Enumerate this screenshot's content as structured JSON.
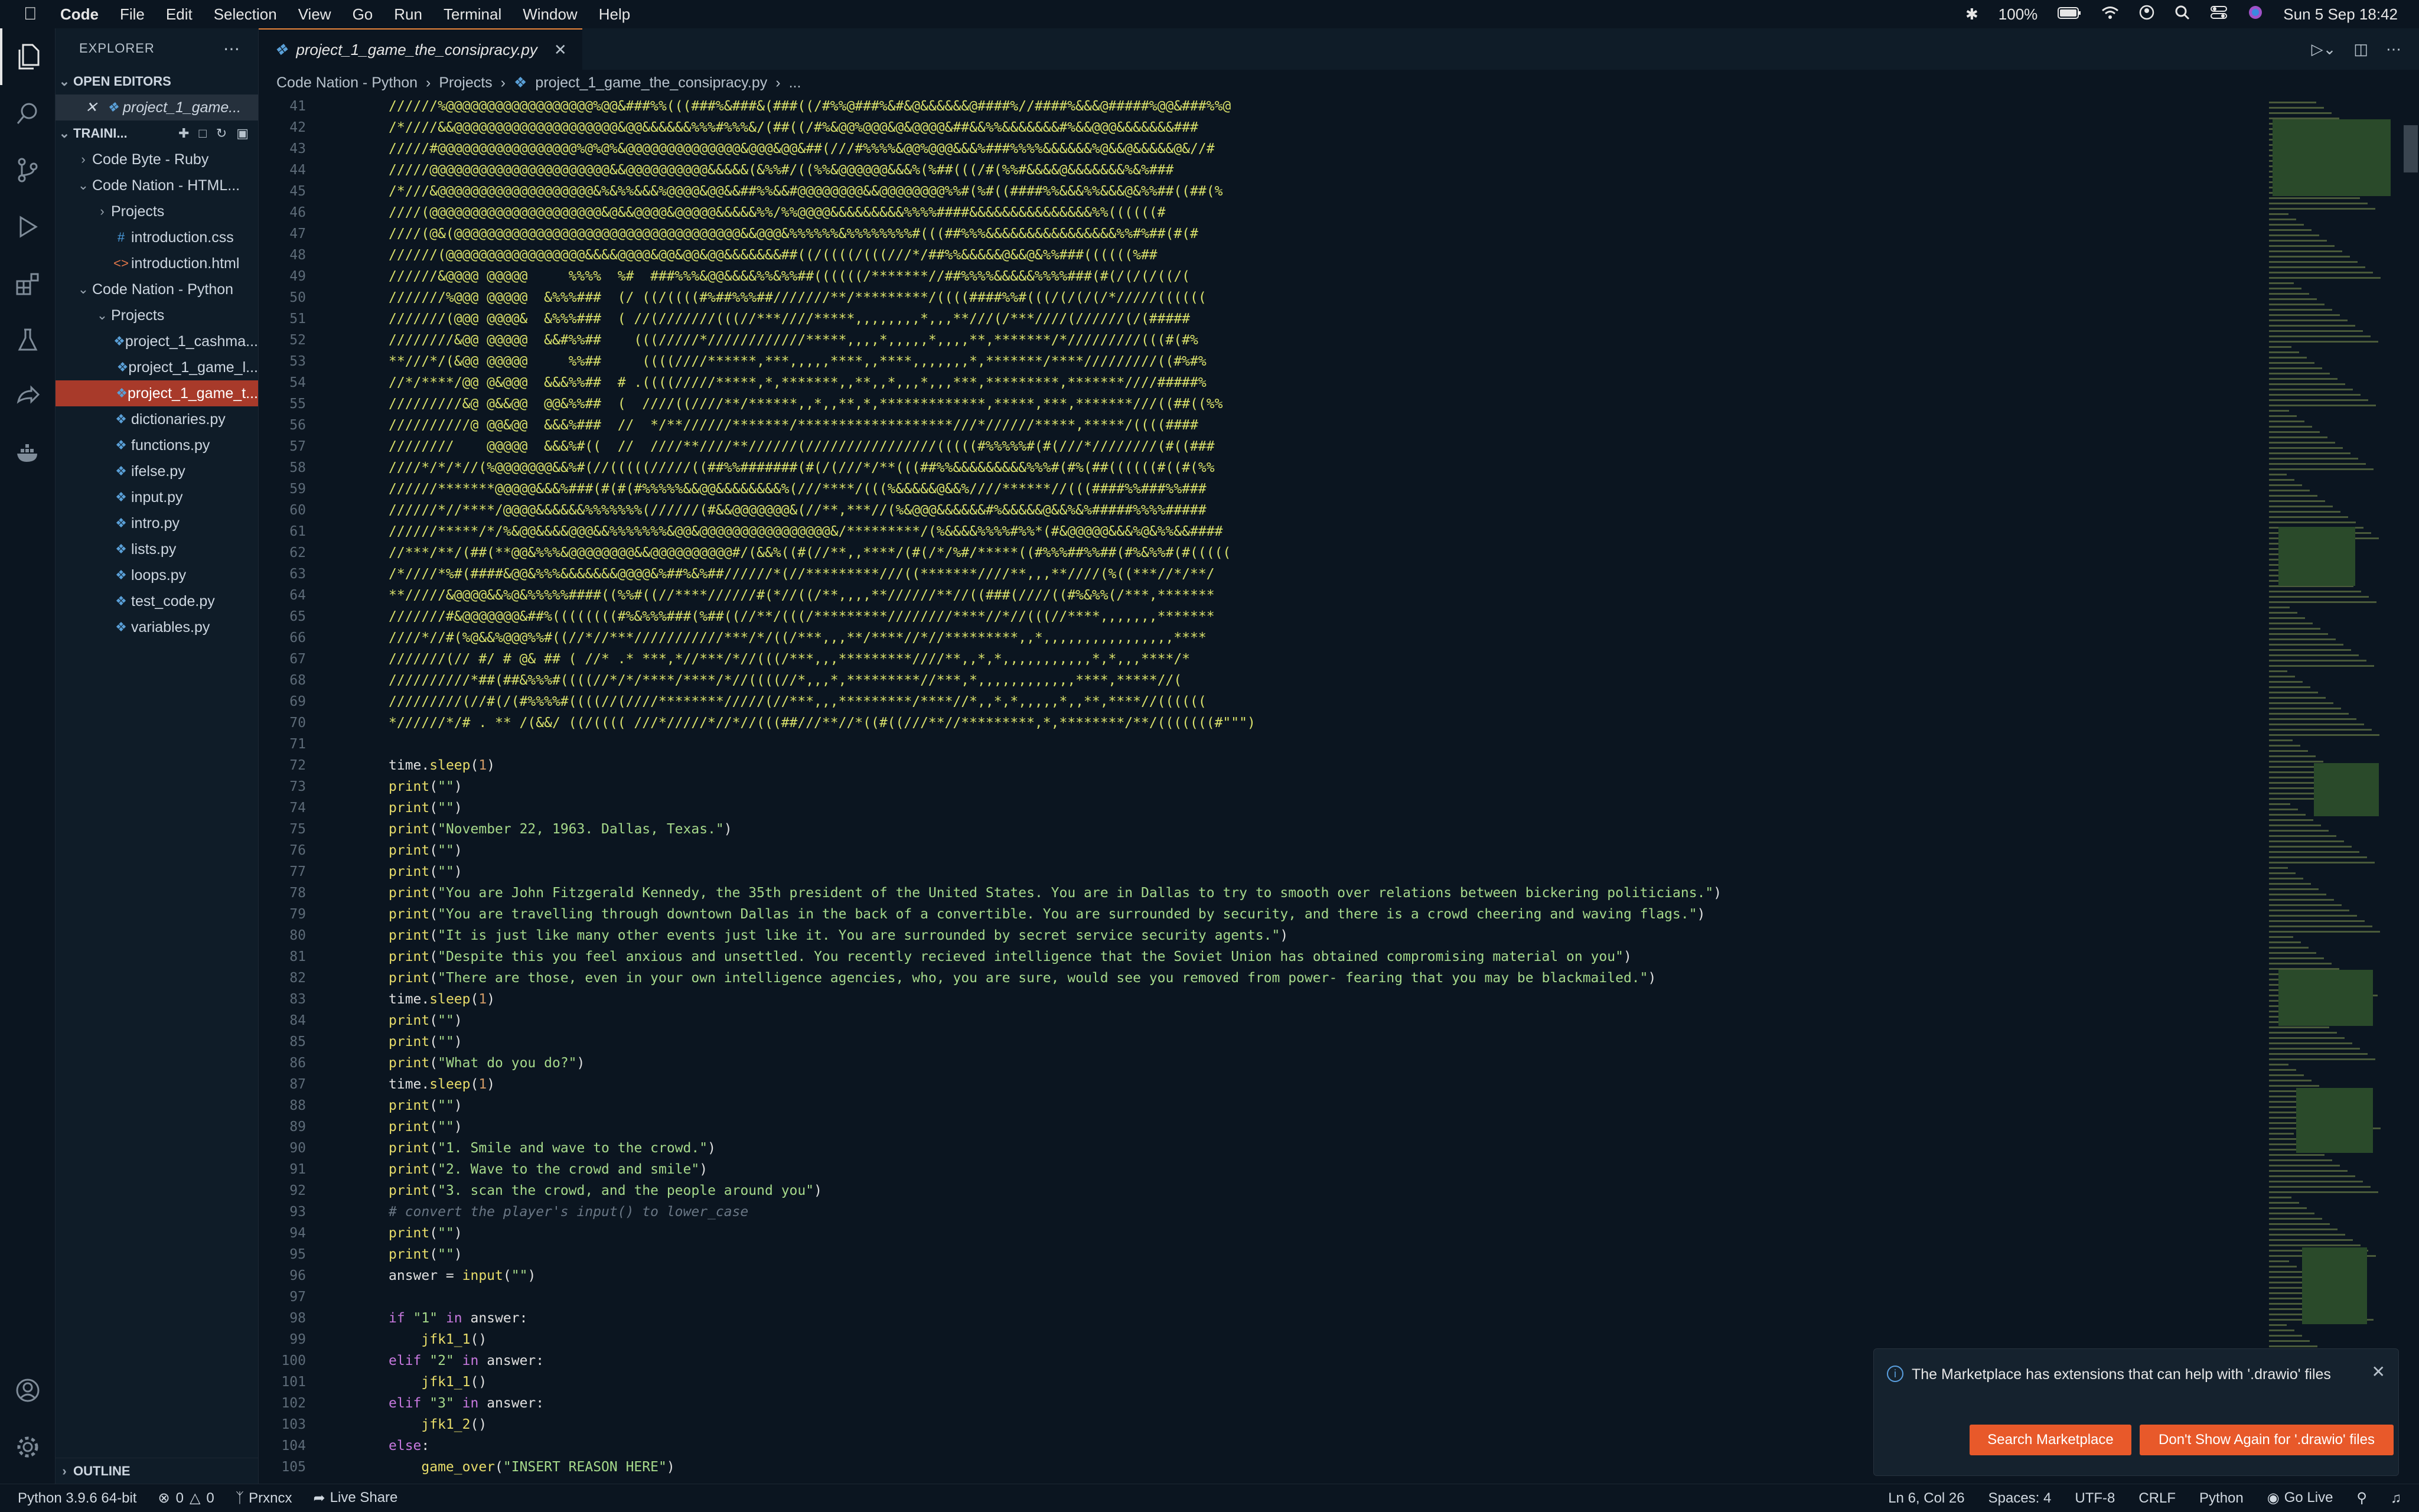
{
  "menubar": {
    "app": "Code",
    "items": [
      "File",
      "Edit",
      "Selection",
      "View",
      "Go",
      "Run",
      "Terminal",
      "Window",
      "Help"
    ],
    "battery": "100%",
    "datetime": "Sun 5 Sep  18:42"
  },
  "explorer": {
    "title": "EXPLORER",
    "open_editors": "OPEN EDITORS",
    "open_file": "project_1_game...",
    "workspace": "TRAINI...",
    "tree": [
      {
        "label": "Code Byte - Ruby",
        "indent": 1,
        "kind": "folder",
        "open": false
      },
      {
        "label": "Code Nation - HTML...",
        "indent": 1,
        "kind": "folder",
        "open": true
      },
      {
        "label": "Projects",
        "indent": 2,
        "kind": "folder",
        "open": false
      },
      {
        "label": "introduction.css",
        "indent": 2,
        "kind": "css"
      },
      {
        "label": "introduction.html",
        "indent": 2,
        "kind": "html"
      },
      {
        "label": "Code Nation - Python",
        "indent": 1,
        "kind": "folder",
        "open": true
      },
      {
        "label": "Projects",
        "indent": 2,
        "kind": "folder",
        "open": true
      },
      {
        "label": "project_1_cashma...",
        "indent": 3,
        "kind": "py"
      },
      {
        "label": "project_1_game_l...",
        "indent": 3,
        "kind": "py"
      },
      {
        "label": "project_1_game_t...",
        "indent": 3,
        "kind": "py",
        "selected": true
      },
      {
        "label": "dictionaries.py",
        "indent": 2,
        "kind": "py"
      },
      {
        "label": "functions.py",
        "indent": 2,
        "kind": "py"
      },
      {
        "label": "ifelse.py",
        "indent": 2,
        "kind": "py"
      },
      {
        "label": "input.py",
        "indent": 2,
        "kind": "py"
      },
      {
        "label": "intro.py",
        "indent": 2,
        "kind": "py"
      },
      {
        "label": "lists.py",
        "indent": 2,
        "kind": "py"
      },
      {
        "label": "loops.py",
        "indent": 2,
        "kind": "py"
      },
      {
        "label": "test_code.py",
        "indent": 2,
        "kind": "py"
      },
      {
        "label": "variables.py",
        "indent": 2,
        "kind": "py"
      }
    ],
    "outline": "OUTLINE"
  },
  "tab": {
    "label": "project_1_game_the_consipracy.py"
  },
  "breadcrumb": [
    "Code Nation - Python",
    "Projects",
    "project_1_game_the_consipracy.py",
    "..."
  ],
  "art_lines": [
    {
      "n": 41,
      "t": "//////%@@@@@@@@@@@@@@@@@@%@@&###%%(((###%&###&(###((/#%%@###%&#&@&&&&&&@####%//####%&&&@#####%@@&###%%@"
    },
    {
      "n": 42,
      "t": "/*////&&@@@@@@@@@@@@@@@@@@@@&@@&&&&&&%%%#%%%&/(##((/#%&@@%@@@&@&@@@@&##&&%%&&&&&&&#%&&@@@&&&&&&&###"
    },
    {
      "n": 43,
      "t": "/////#@@@@@@@@@@@@@@@@@%@%@%&@@@@@@@@@@@@@@&@@@&@@&##(///#%%%%&@@%@@@&&&%###%%%%&&&&&&%@&&@&&&&&@&//#"
    },
    {
      "n": 44,
      "t": "/////@@@@@@@@@@@@@@@@@@@@@@&&@@@@@@@@@@&&&&&(&%%#/((%%&@@@@@@&&&%(%##(((/#(%%#&&&&@&&&&&&&%&%###"
    },
    {
      "n": 45,
      "t": "/*///&@@@@@@@@@@@@@@@@@@@&%&%%&&&%@@@@&@@&&##%%&&#@@@@@@@@&&@@@@@@@@%%#(%#((####%%&&&%%&&&@&%%##((##(%"
    },
    {
      "n": 46,
      "t": "////(@@@@@@@@@@@@@@@@@@@@@&@&&@@@@&@@@@@&&&&&%%/%%@@@@&&&&&&&&&%%%%####&&&&&&&&&&&&&&&%%((((((#"
    },
    {
      "n": 47,
      "t": "////(@&(@@@@@@@@@@@@@@@@@@@@@@@@@@@@@@@@@@@&&@@@&%%%%%%&%%%%%%%%#(((##%%%&&&&&&&&&&&&&&&&%%#%##(#(#"
    },
    {
      "n": 48,
      "t": "//////(@@@@@@@@@@@@@@@@@&&&&@@@@&@@&@@&@@&&&&&&&##((/((((/(((///*/##%%&&&&&@&&@&%%###((((((%##"
    },
    {
      "n": 49,
      "t": "//////&@@@@ @@@@@     %%%%  %#  ###%%%&@@&&&&%%&%%##((((((/*******//##%%%%&&&&&%%%%###(#(/(/(/((/("
    },
    {
      "n": 50,
      "t": "///////%@@@ @@@@@  &%%%###  (/ ((/((((#%##%%%##///////**/*********/((((####%%#(((/(/(/(/*/////(((((("
    },
    {
      "n": 51,
      "t": "///////(@@@ @@@@&  &%%%###  ( //(///////(((//***////*****,,,,,,,,*,,,**///(/***////(//////(/(#####"
    },
    {
      "n": 52,
      "t": "////////&@@ @@@@@  &&#%%##    (((/////*////////////*****,,,,*,,,,,*,,,,**,*******/*/////////(((#(#%"
    },
    {
      "n": 53,
      "t": "**///*/(&@@ @@@@@     %%##     ((((////******,***,,,,,****,,****,,,,,,,*,*******/****/////////((#%#%"
    },
    {
      "n": 54,
      "t": "//*/****/@@ @&@@@  &&&%%##  # .((((/////*****,*,*******,,**,,*,,,*,,,***,*********,*******////#####%"
    },
    {
      "n": 55,
      "t": "/////////&@ @&&@@  @@&%%##  (  ////((////**/******,,*,,**,*,*************,*****,***,*******///((##((%%"
    },
    {
      "n": 56,
      "t": "//////////@ @@&@@  &&&%###  //  */**//////*******/*******************///*//////*****,*****/((((####"
    },
    {
      "n": 57,
      "t": "////////    @@@@@  &&&%#((  //  ////**////**//////(////////////////(((((#%%%%%#(#(///*////////(#((###"
    },
    {
      "n": 58,
      "t": "////*/*/*//(%@@@@@@@&&%#(//(((((/////((##%%#######(#(/(///*/**(((##%%&&&&&&&&&%%%#(#%(##((((((#((#(%%"
    },
    {
      "n": 59,
      "t": "//////*******@@@@@&&&%###(#(#(#%%%%%&&@@&&&&&&&&%(///****/(((%&&&&&@&&%////******//(((####%%###%%###"
    },
    {
      "n": 60,
      "t": "//////*//****/@@@@&&&&&&%%%%%%%(//////(#&&@@@@@@@&(//**,***//(%&@@@&&&&&&#%&&&&&@&&%&%#####%%%%#####"
    },
    {
      "n": 61,
      "t": "//////*****/*/%&@@&&&&@@@&&%%%%%%%&@@&@@@@@@@@@@@@@@@@&/*********/(%&&&&%%%%#%%*(#&@@@@@&&&%@&%%&&####"
    },
    {
      "n": 62,
      "t": "//***/**/(##(**@@&%%%&@@@@@@@@&&@@@@@@@@@@#/(&&%((#(//**,,****/(#(/*/%#/*****((#%%%##%%##(#%&%%#(#((((("
    },
    {
      "n": 63,
      "t": "/*////*%#(####&@@&%%%&&&&&&&@@@@&%##%&%##//////*(//*********///((*******////**,,,**////(%((***//*/**/"
    },
    {
      "n": 64,
      "t": "**/////&@@@@&&%@&%%%%%####((%%#((//****//////#(*//((/**,,,,**//////**//((###(////((#%&%%(/***,*******"
    },
    {
      "n": 65,
      "t": "///////#&@@@@@@@&##%((((((((#%&%%%###(%##((//**/(((/*********////////****//*//(((//****,,,,,,,*******"
    },
    {
      "n": 66,
      "t": "////*//#(%@&&%@@@%%#((//*//***///////////***/*/((/***,,,**/****//*//*********,,*,,,,,,,,,,,,,,,,****"
    },
    {
      "n": 67,
      "t": "///////(// #/ # @& ## ( //* .* ***,*//***/*//(((/***,,,*********////**,,*,*,,,,,,,,,,,*,*,,,****/*"
    },
    {
      "n": 68,
      "t": "//////////*##(##&%%%#((((//*/*/****/****/*//((((//*,,,*,*********//***,*,,,,,,,,,,,,****,*****//("
    },
    {
      "n": 69,
      "t": "/////////(//#(/(#%%%%#((((//(////********/////(//***,,,*********/****//*,,*,*,,,,,*,,**,****//(((((("
    },
    {
      "n": 70,
      "t": "*//////*/# . ** /(&&/ ((/(((( ///*/////*//*//(((##///**//*((#((///**//*********,*,********/**/(((((((#\"\"\")"
    }
  ],
  "code_lines": [
    {
      "n": 71,
      "seg": []
    },
    {
      "n": 72,
      "seg": [
        [
          "time.",
          "k-var"
        ],
        [
          "sleep",
          "k-fn"
        ],
        [
          "(",
          "k-pl"
        ],
        [
          "1",
          "k-num"
        ],
        [
          ")",
          "k-pl"
        ]
      ]
    },
    {
      "n": 73,
      "seg": [
        [
          "print",
          "k-fn"
        ],
        [
          "(",
          "k-pl"
        ],
        [
          "\"\"",
          "k-str"
        ],
        [
          ")",
          "k-pl"
        ]
      ]
    },
    {
      "n": 74,
      "seg": [
        [
          "print",
          "k-fn"
        ],
        [
          "(",
          "k-pl"
        ],
        [
          "\"\"",
          "k-str"
        ],
        [
          ")",
          "k-pl"
        ]
      ]
    },
    {
      "n": 75,
      "seg": [
        [
          "print",
          "k-fn"
        ],
        [
          "(",
          "k-pl"
        ],
        [
          "\"November 22, 1963. Dallas, Texas.\"",
          "k-str"
        ],
        [
          ")",
          "k-pl"
        ]
      ]
    },
    {
      "n": 76,
      "seg": [
        [
          "print",
          "k-fn"
        ],
        [
          "(",
          "k-pl"
        ],
        [
          "\"\"",
          "k-str"
        ],
        [
          ")",
          "k-pl"
        ]
      ]
    },
    {
      "n": 77,
      "seg": [
        [
          "print",
          "k-fn"
        ],
        [
          "(",
          "k-pl"
        ],
        [
          "\"\"",
          "k-str"
        ],
        [
          ")",
          "k-pl"
        ]
      ]
    },
    {
      "n": 78,
      "seg": [
        [
          "print",
          "k-fn"
        ],
        [
          "(",
          "k-pl"
        ],
        [
          "\"You are John Fitzgerald Kennedy, the 35th president of the United States. You are in Dallas to try to smooth over relations between bickering politicians.\"",
          "k-str"
        ],
        [
          ")",
          "k-pl"
        ]
      ]
    },
    {
      "n": 79,
      "seg": [
        [
          "print",
          "k-fn"
        ],
        [
          "(",
          "k-pl"
        ],
        [
          "\"You are travelling through downtown Dallas in the back of a convertible. You are surrounded by security, and there is a crowd cheering and waving flags.\"",
          "k-str"
        ],
        [
          ")",
          "k-pl"
        ]
      ]
    },
    {
      "n": 80,
      "seg": [
        [
          "print",
          "k-fn"
        ],
        [
          "(",
          "k-pl"
        ],
        [
          "\"It is just like many other events just like it. You are surrounded by secret service security agents.\"",
          "k-str"
        ],
        [
          ")",
          "k-pl"
        ]
      ]
    },
    {
      "n": 81,
      "seg": [
        [
          "print",
          "k-fn"
        ],
        [
          "(",
          "k-pl"
        ],
        [
          "\"Despite this you feel anxious and unsettled. You recently recieved intelligence that the Soviet Union has obtained compromising material on you\"",
          "k-str"
        ],
        [
          ")",
          "k-pl"
        ]
      ]
    },
    {
      "n": 82,
      "seg": [
        [
          "print",
          "k-fn"
        ],
        [
          "(",
          "k-pl"
        ],
        [
          "\"There are those, even in your own intelligence agencies, who, you are sure, would see you removed from power- fearing that you may be blackmailed.\"",
          "k-str"
        ],
        [
          ")",
          "k-pl"
        ]
      ]
    },
    {
      "n": 83,
      "seg": [
        [
          "time.",
          "k-var"
        ],
        [
          "sleep",
          "k-fn"
        ],
        [
          "(",
          "k-pl"
        ],
        [
          "1",
          "k-num"
        ],
        [
          ")",
          "k-pl"
        ]
      ]
    },
    {
      "n": 84,
      "seg": [
        [
          "print",
          "k-fn"
        ],
        [
          "(",
          "k-pl"
        ],
        [
          "\"\"",
          "k-str"
        ],
        [
          ")",
          "k-pl"
        ]
      ]
    },
    {
      "n": 85,
      "seg": [
        [
          "print",
          "k-fn"
        ],
        [
          "(",
          "k-pl"
        ],
        [
          "\"\"",
          "k-str"
        ],
        [
          ")",
          "k-pl"
        ]
      ]
    },
    {
      "n": 86,
      "seg": [
        [
          "print",
          "k-fn"
        ],
        [
          "(",
          "k-pl"
        ],
        [
          "\"What do you do?\"",
          "k-str"
        ],
        [
          ")",
          "k-pl"
        ]
      ]
    },
    {
      "n": 87,
      "seg": [
        [
          "time.",
          "k-var"
        ],
        [
          "sleep",
          "k-fn"
        ],
        [
          "(",
          "k-pl"
        ],
        [
          "1",
          "k-num"
        ],
        [
          ")",
          "k-pl"
        ]
      ]
    },
    {
      "n": 88,
      "seg": [
        [
          "print",
          "k-fn"
        ],
        [
          "(",
          "k-pl"
        ],
        [
          "\"\"",
          "k-str"
        ],
        [
          ")",
          "k-pl"
        ]
      ]
    },
    {
      "n": 89,
      "seg": [
        [
          "print",
          "k-fn"
        ],
        [
          "(",
          "k-pl"
        ],
        [
          "\"\"",
          "k-str"
        ],
        [
          ")",
          "k-pl"
        ]
      ]
    },
    {
      "n": 90,
      "seg": [
        [
          "print",
          "k-fn"
        ],
        [
          "(",
          "k-pl"
        ],
        [
          "\"1. Smile and wave to the crowd.\"",
          "k-str"
        ],
        [
          ")",
          "k-pl"
        ]
      ]
    },
    {
      "n": 91,
      "seg": [
        [
          "print",
          "k-fn"
        ],
        [
          "(",
          "k-pl"
        ],
        [
          "\"2. Wave to the crowd and smile\"",
          "k-str"
        ],
        [
          ")",
          "k-pl"
        ]
      ]
    },
    {
      "n": 92,
      "seg": [
        [
          "print",
          "k-fn"
        ],
        [
          "(",
          "k-pl"
        ],
        [
          "\"3. scan the crowd, and the people around you\"",
          "k-str"
        ],
        [
          ")",
          "k-pl"
        ]
      ]
    },
    {
      "n": 93,
      "seg": [
        [
          "# convert the player's input() to lower_case",
          "k-com"
        ]
      ]
    },
    {
      "n": 94,
      "seg": [
        [
          "print",
          "k-fn"
        ],
        [
          "(",
          "k-pl"
        ],
        [
          "\"\"",
          "k-str"
        ],
        [
          ")",
          "k-pl"
        ]
      ]
    },
    {
      "n": 95,
      "seg": [
        [
          "print",
          "k-fn"
        ],
        [
          "(",
          "k-pl"
        ],
        [
          "\"\"",
          "k-str"
        ],
        [
          ")",
          "k-pl"
        ]
      ]
    },
    {
      "n": 96,
      "seg": [
        [
          "answer = ",
          "k-var"
        ],
        [
          "input",
          "k-fn"
        ],
        [
          "(",
          "k-pl"
        ],
        [
          "\"\"",
          "k-str"
        ],
        [
          ")",
          "k-pl"
        ]
      ]
    },
    {
      "n": 97,
      "seg": []
    },
    {
      "n": 98,
      "seg": [
        [
          "if ",
          "k-kw"
        ],
        [
          "\"1\"",
          "k-str"
        ],
        [
          " in ",
          "k-kw"
        ],
        [
          "answer:",
          "k-var"
        ]
      ]
    },
    {
      "n": 99,
      "seg": [
        [
          "    ",
          "k-pl"
        ],
        [
          "jfk1_1",
          "k-fn"
        ],
        [
          "()",
          "k-pl"
        ]
      ]
    },
    {
      "n": 100,
      "seg": [
        [
          "elif ",
          "k-kw"
        ],
        [
          "\"2\"",
          "k-str"
        ],
        [
          " in ",
          "k-kw"
        ],
        [
          "answer:",
          "k-var"
        ]
      ]
    },
    {
      "n": 101,
      "seg": [
        [
          "    ",
          "k-pl"
        ],
        [
          "jfk1_1",
          "k-fn"
        ],
        [
          "()",
          "k-pl"
        ]
      ]
    },
    {
      "n": 102,
      "seg": [
        [
          "elif ",
          "k-kw"
        ],
        [
          "\"3\"",
          "k-str"
        ],
        [
          " in ",
          "k-kw"
        ],
        [
          "answer:",
          "k-var"
        ]
      ]
    },
    {
      "n": 103,
      "seg": [
        [
          "    ",
          "k-pl"
        ],
        [
          "jfk1_2",
          "k-fn"
        ],
        [
          "()",
          "k-pl"
        ]
      ]
    },
    {
      "n": 104,
      "seg": [
        [
          "else",
          "k-kw"
        ],
        [
          ":",
          "k-pl"
        ]
      ]
    },
    {
      "n": 105,
      "seg": [
        [
          "    ",
          "k-pl"
        ],
        [
          "game_over",
          "k-fn"
        ],
        [
          "(",
          "k-pl"
        ],
        [
          "\"INSERT REASON HERE\"",
          "k-str"
        ],
        [
          ")",
          "k-pl"
        ]
      ]
    }
  ],
  "notification": {
    "message": "The Marketplace has extensions that can help with '.drawio' files",
    "primary": "Search Marketplace",
    "secondary": "Don't Show Again for '.drawio' files"
  },
  "statusbar": {
    "python": "Python 3.9.6 64-bit",
    "errors": "0",
    "warnings": "0",
    "user": "Prxncx",
    "liveshare": "Live Share",
    "position": "Ln 6, Col 26",
    "spaces": "Spaces: 4",
    "encoding": "UTF-8",
    "eol": "CRLF",
    "lang": "Python",
    "golive": "Go Live"
  }
}
